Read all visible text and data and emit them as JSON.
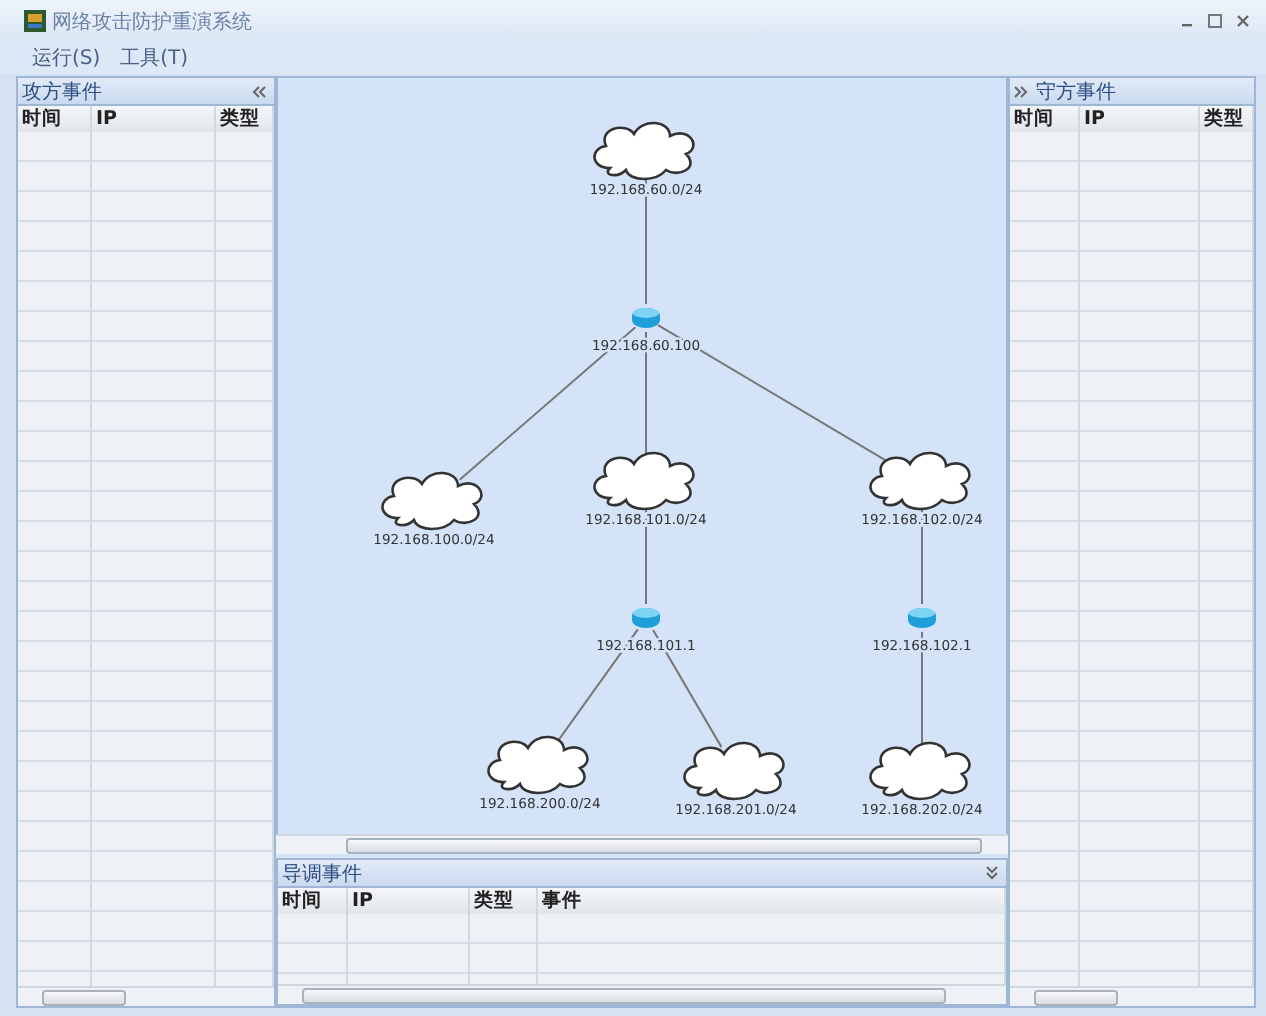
{
  "window": {
    "title": "网络攻击防护重演系统"
  },
  "menu": [
    {
      "label": "运行(S)"
    },
    {
      "label": "工具(T)"
    }
  ],
  "attacker_panel": {
    "title": "攻方事件",
    "columns": [
      "时间",
      "IP",
      "类型"
    ]
  },
  "defender_panel": {
    "title": "守方事件",
    "columns": [
      "时间",
      "IP",
      "类型"
    ]
  },
  "topology": {
    "kind": "cloud",
    "label": "192.168.60.0/24",
    "children": [
      {
        "kind": "router",
        "label": "192.168.60.100",
        "children": [
          {
            "kind": "cloud",
            "label": "192.168.100.0/24"
          },
          {
            "kind": "cloud",
            "label": "192.168.101.0/24",
            "children": [
              {
                "kind": "router",
                "label": "192.168.101.1",
                "children": [
                  {
                    "kind": "cloud",
                    "label": "192.168.200.0/24"
                  },
                  {
                    "kind": "cloud",
                    "label": "192.168.201.0/24"
                  }
                ]
              }
            ]
          },
          {
            "kind": "cloud",
            "label": "192.168.102.0/24",
            "children": [
              {
                "kind": "router",
                "label": "192.168.102.1",
                "children": [
                  {
                    "kind": "cloud",
                    "label": "192.168.202.0/24"
                  }
                ]
              }
            ]
          }
        ]
      }
    ]
  },
  "control_panel": {
    "title": "导调事件",
    "columns": [
      "时间",
      "IP",
      "类型",
      "事件"
    ]
  }
}
